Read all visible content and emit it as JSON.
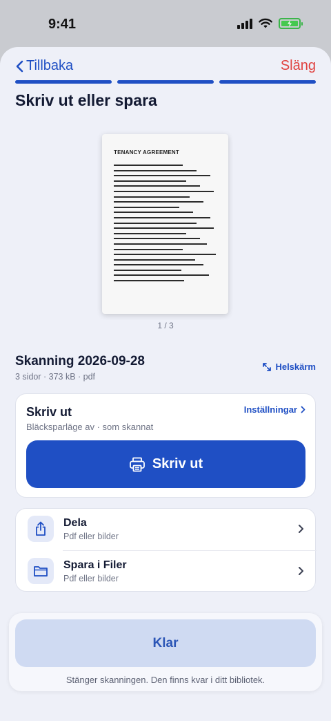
{
  "status_bar": {
    "time": "9:41"
  },
  "nav": {
    "back_label": "Tillbaka",
    "discard_label": "Släng"
  },
  "progress": {
    "steps_total": 3,
    "steps_completed": 3
  },
  "page_title": "Skriv ut eller spara",
  "preview": {
    "heading": "TENANCY AGREEMENT",
    "page_counter": "1 / 3"
  },
  "scan": {
    "name": "Skanning 2026-09-28",
    "meta": "3 sidor · 373 kB · pdf",
    "fullscreen_label": "Helskärm"
  },
  "print_card": {
    "title": "Skriv ut",
    "subtitle": "Bläcksparläge av · som skannat",
    "settings_label": "Inställningar",
    "button_label": "Skriv ut"
  },
  "actions": [
    {
      "label": "Dela",
      "sub": "Pdf eller bilder",
      "icon": "share-icon"
    },
    {
      "label": "Spara i Filer",
      "sub": "Pdf eller bilder",
      "icon": "folder-icon"
    }
  ],
  "bottom": {
    "done_label": "Klar",
    "hint": "Stänger skanningen. Den finns kvar i ditt bibliotek."
  },
  "colors": {
    "accent": "#1f4fc4",
    "destructive": "#e0403e",
    "background": "#eef0f8",
    "battery": "#45c94f"
  }
}
